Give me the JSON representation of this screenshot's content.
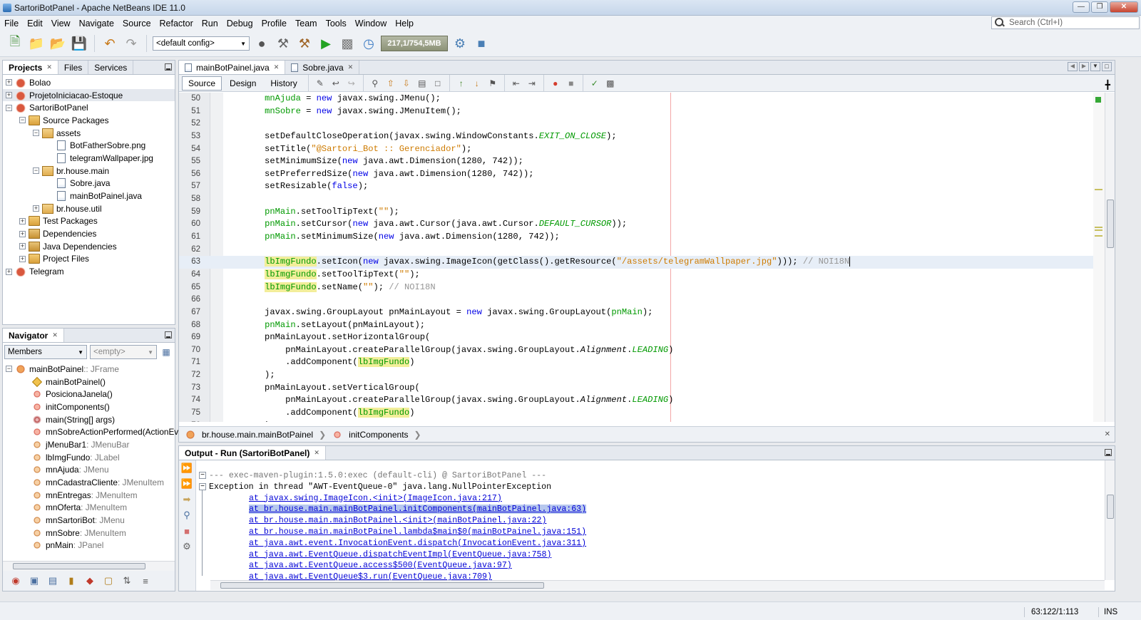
{
  "window": {
    "title": "SartoriBotPanel - Apache NetBeans IDE 11.0"
  },
  "menu": [
    "File",
    "Edit",
    "View",
    "Navigate",
    "Source",
    "Refactor",
    "Run",
    "Debug",
    "Profile",
    "Team",
    "Tools",
    "Window",
    "Help"
  ],
  "search": {
    "placeholder": "Search (Ctrl+I)"
  },
  "toolbar": {
    "config": "<default config>",
    "memory": "217,1/754,5MB"
  },
  "projects_panel": {
    "tabs": [
      "Projects",
      "Files",
      "Services"
    ],
    "tree": [
      {
        "label": "Bolao",
        "icon": "project-icon",
        "level": 0,
        "exp": "+"
      },
      {
        "label": "ProjetoIniciacao-Estoque",
        "icon": "project-icon",
        "level": 0,
        "exp": "+"
      },
      {
        "label": "SartoriBotPanel",
        "icon": "project-icon",
        "level": 0,
        "exp": "-"
      },
      {
        "label": "Source Packages",
        "icon": "source-folder-icon",
        "level": 1,
        "exp": "-"
      },
      {
        "label": "assets",
        "icon": "package-icon",
        "level": 2,
        "exp": "-"
      },
      {
        "label": "BotFatherSobre.png",
        "icon": "image-file-icon",
        "level": 3,
        "exp": ""
      },
      {
        "label": "telegramWallpaper.jpg",
        "icon": "image-file-icon",
        "level": 3,
        "exp": ""
      },
      {
        "label": "br.house.main",
        "icon": "package-icon",
        "level": 2,
        "exp": "-"
      },
      {
        "label": "Sobre.java",
        "icon": "java-file-icon",
        "level": 3,
        "exp": ""
      },
      {
        "label": "mainBotPainel.java",
        "icon": "java-file-icon",
        "level": 3,
        "exp": ""
      },
      {
        "label": "br.house.util",
        "icon": "package-icon",
        "level": 2,
        "exp": "+"
      },
      {
        "label": "Test Packages",
        "icon": "source-folder-icon",
        "level": 1,
        "exp": "+"
      },
      {
        "label": "Dependencies",
        "icon": "library-icon",
        "level": 1,
        "exp": "+"
      },
      {
        "label": "Java Dependencies",
        "icon": "library-icon",
        "level": 1,
        "exp": "+"
      },
      {
        "label": "Project Files",
        "icon": "source-folder-icon",
        "level": 1,
        "exp": "+"
      },
      {
        "label": "Telegram",
        "icon": "project-icon",
        "level": 0,
        "exp": "+"
      }
    ]
  },
  "navigator": {
    "title": "Navigator",
    "filter": "Members",
    "empty": "<empty>",
    "root": {
      "name": "mainBotPainel",
      "type": " :: JFrame"
    },
    "members": [
      {
        "name": "mainBotPainel()",
        "type": "",
        "icon": "constructor-icon"
      },
      {
        "name": "PosicionaJanela()",
        "type": "",
        "icon": "method-icon"
      },
      {
        "name": "initComponents()",
        "type": "",
        "icon": "method-icon"
      },
      {
        "name": "main(String[] args)",
        "type": "",
        "icon": "static-method-icon"
      },
      {
        "name": "mnSobreActionPerformed(ActionEvent",
        "type": "",
        "icon": "method-icon"
      },
      {
        "name": "jMenuBar1",
        "type": " : JMenuBar",
        "icon": "field-icon"
      },
      {
        "name": "lbImgFundo",
        "type": " : JLabel",
        "icon": "field-icon"
      },
      {
        "name": "mnAjuda",
        "type": " : JMenu",
        "icon": "field-icon"
      },
      {
        "name": "mnCadastraCliente",
        "type": " : JMenuItem",
        "icon": "field-icon"
      },
      {
        "name": "mnEntregas",
        "type": " : JMenuItem",
        "icon": "field-icon"
      },
      {
        "name": "mnOferta",
        "type": " : JMenuItem",
        "icon": "field-icon"
      },
      {
        "name": "mnSartoriBot",
        "type": " : JMenu",
        "icon": "field-icon"
      },
      {
        "name": "mnSobre",
        "type": " : JMenuItem",
        "icon": "field-icon"
      },
      {
        "name": "pnMain",
        "type": " : JPanel",
        "icon": "field-icon"
      }
    ]
  },
  "editor": {
    "tabs": [
      "mainBotPainel.java",
      "Sobre.java"
    ],
    "views": [
      "Source",
      "Design",
      "History"
    ],
    "breadcrumb": [
      "br.house.main.mainBotPainel",
      "initComponents"
    ],
    "lines": [
      {
        "n": "50",
        "seg": [
          [
            "",
            "        "
          ],
          [
            "fld",
            "mnAjuda"
          ],
          [
            "",
            " = "
          ],
          [
            "kw",
            "new"
          ],
          [
            "",
            " javax.swing.JMenu();"
          ]
        ]
      },
      {
        "n": "51",
        "seg": [
          [
            "",
            "        "
          ],
          [
            "fld",
            "mnSobre"
          ],
          [
            "",
            " = "
          ],
          [
            "kw",
            "new"
          ],
          [
            "",
            " javax.swing.JMenuItem();"
          ]
        ]
      },
      {
        "n": "52",
        "seg": []
      },
      {
        "n": "53",
        "seg": [
          [
            "",
            "        setDefaultCloseOperation(javax.swing.WindowConstants."
          ],
          [
            "fld it",
            "EXIT_ON_CLOSE"
          ],
          [
            "",
            ");"
          ]
        ]
      },
      {
        "n": "54",
        "seg": [
          [
            "",
            "        setTitle("
          ],
          [
            "str",
            "\"@Sartori_Bot :: Gerenciador\""
          ],
          [
            "",
            ");"
          ]
        ]
      },
      {
        "n": "55",
        "seg": [
          [
            "",
            "        setMinimumSize("
          ],
          [
            "kw",
            "new"
          ],
          [
            "",
            " java.awt.Dimension(1280, 742));"
          ]
        ]
      },
      {
        "n": "56",
        "seg": [
          [
            "",
            "        setPreferredSize("
          ],
          [
            "kw",
            "new"
          ],
          [
            "",
            " java.awt.Dimension(1280, 742));"
          ]
        ]
      },
      {
        "n": "57",
        "seg": [
          [
            "",
            "        setResizable("
          ],
          [
            "kw",
            "false"
          ],
          [
            "",
            ");"
          ]
        ]
      },
      {
        "n": "58",
        "seg": []
      },
      {
        "n": "59",
        "seg": [
          [
            "",
            "        "
          ],
          [
            "fld",
            "pnMain"
          ],
          [
            "",
            ".setToolTipText("
          ],
          [
            "str",
            "\"\""
          ],
          [
            "",
            ");"
          ]
        ]
      },
      {
        "n": "60",
        "seg": [
          [
            "",
            "        "
          ],
          [
            "fld",
            "pnMain"
          ],
          [
            "",
            ".setCursor("
          ],
          [
            "kw",
            "new"
          ],
          [
            "",
            " java.awt.Cursor(java.awt.Cursor."
          ],
          [
            "fld it",
            "DEFAULT_CURSOR"
          ],
          [
            "",
            "));"
          ]
        ]
      },
      {
        "n": "61",
        "seg": [
          [
            "",
            "        "
          ],
          [
            "fld",
            "pnMain"
          ],
          [
            "",
            ".setMinimumSize("
          ],
          [
            "kw",
            "new"
          ],
          [
            "",
            " java.awt.Dimension(1280, 742));"
          ]
        ]
      },
      {
        "n": "62",
        "seg": []
      },
      {
        "n": "63",
        "cur": true,
        "seg": [
          [
            "",
            "        "
          ],
          [
            "fld hl",
            "lbImgFundo"
          ],
          [
            "",
            ".setIcon("
          ],
          [
            "kw",
            "new"
          ],
          [
            "",
            " javax.swing.ImageIcon(getClass().getResource("
          ],
          [
            "str",
            "\"/assets/telegramWallpaper.jpg\""
          ],
          [
            "",
            ")));"
          ],
          [
            "cmt",
            " // NOI18N"
          ]
        ]
      },
      {
        "n": "64",
        "seg": [
          [
            "",
            "        "
          ],
          [
            "fld hl",
            "lbImgFundo"
          ],
          [
            "",
            ".setToolTipText("
          ],
          [
            "str",
            "\"\""
          ],
          [
            "",
            ");"
          ]
        ]
      },
      {
        "n": "65",
        "seg": [
          [
            "",
            "        "
          ],
          [
            "fld hl",
            "lbImgFundo"
          ],
          [
            "",
            ".setName("
          ],
          [
            "str",
            "\"\""
          ],
          [
            "",
            ");"
          ],
          [
            "cmt",
            " // NOI18N"
          ]
        ]
      },
      {
        "n": "66",
        "seg": []
      },
      {
        "n": "67",
        "seg": [
          [
            "",
            "        javax.swing.GroupLayout pnMainLayout = "
          ],
          [
            "kw",
            "new"
          ],
          [
            "",
            " javax.swing.GroupLayout("
          ],
          [
            "fld",
            "pnMain"
          ],
          [
            "",
            ");"
          ]
        ]
      },
      {
        "n": "68",
        "seg": [
          [
            "",
            "        "
          ],
          [
            "fld",
            "pnMain"
          ],
          [
            "",
            ".setLayout(pnMainLayout);"
          ]
        ]
      },
      {
        "n": "69",
        "seg": [
          [
            "",
            "        pnMainLayout.setHorizontalGroup("
          ]
        ]
      },
      {
        "n": "70",
        "seg": [
          [
            "",
            "            pnMainLayout.createParallelGroup(javax.swing.GroupLayout."
          ],
          [
            "it",
            "Alignment"
          ],
          [
            "",
            "."
          ],
          [
            "fld it",
            "LEADING"
          ],
          [
            "",
            ")"
          ]
        ]
      },
      {
        "n": "71",
        "seg": [
          [
            "",
            "            .addComponent("
          ],
          [
            "fld hl",
            "lbImgFundo"
          ],
          [
            "",
            ")"
          ]
        ]
      },
      {
        "n": "72",
        "seg": [
          [
            "",
            "        );"
          ]
        ]
      },
      {
        "n": "73",
        "seg": [
          [
            "",
            "        pnMainLayout.setVerticalGroup("
          ]
        ]
      },
      {
        "n": "74",
        "seg": [
          [
            "",
            "            pnMainLayout.createParallelGroup(javax.swing.GroupLayout."
          ],
          [
            "it",
            "Alignment"
          ],
          [
            "",
            "."
          ],
          [
            "fld it",
            "LEADING"
          ],
          [
            "",
            ")"
          ]
        ]
      },
      {
        "n": "75",
        "seg": [
          [
            "",
            "            .addComponent("
          ],
          [
            "fld hl",
            "lbImgFundo"
          ],
          [
            "",
            ")"
          ]
        ]
      },
      {
        "n": "76",
        "seg": [
          [
            "",
            "        );"
          ]
        ]
      }
    ]
  },
  "output": {
    "title": "Output - Run (SartoriBotPanel)",
    "lines": [
      {
        "t": "--- exec-maven-plugin:1.5.0:exec (default-cli) @ SartoriBotPanel ---",
        "link": false,
        "ind": false,
        "sel": false,
        "gray": true
      },
      {
        "t": "Exception in thread \"AWT-EventQueue-0\" java.lang.NullPointerException",
        "link": false,
        "ind": false,
        "sel": false,
        "gray": false
      },
      {
        "t": "at javax.swing.ImageIcon.<init>(ImageIcon.java:217)",
        "link": true,
        "ind": true,
        "sel": false,
        "gray": false
      },
      {
        "t": "at br.house.main.mainBotPainel.initComponents(mainBotPainel.java:63)",
        "link": true,
        "ind": true,
        "sel": true,
        "gray": false
      },
      {
        "t": "at br.house.main.mainBotPainel.<init>(mainBotPainel.java:22)",
        "link": true,
        "ind": true,
        "sel": false,
        "gray": false
      },
      {
        "t": "at br.house.main.mainBotPainel.lambda$main$0(mainBotPainel.java:151)",
        "link": true,
        "ind": true,
        "sel": false,
        "gray": false
      },
      {
        "t": "at java.awt.event.InvocationEvent.dispatch(InvocationEvent.java:311)",
        "link": true,
        "ind": true,
        "sel": false,
        "gray": false
      },
      {
        "t": "at java.awt.EventQueue.dispatchEventImpl(EventQueue.java:758)",
        "link": true,
        "ind": true,
        "sel": false,
        "gray": false
      },
      {
        "t": "at java.awt.EventQueue.access$500(EventQueue.java:97)",
        "link": true,
        "ind": true,
        "sel": false,
        "gray": false
      },
      {
        "t": "at java.awt.EventQueue$3.run(EventQueue.java:709)",
        "link": true,
        "ind": true,
        "sel": false,
        "gray": false
      }
    ]
  },
  "status": {
    "position": "63:122/1:113",
    "mode": "INS"
  }
}
